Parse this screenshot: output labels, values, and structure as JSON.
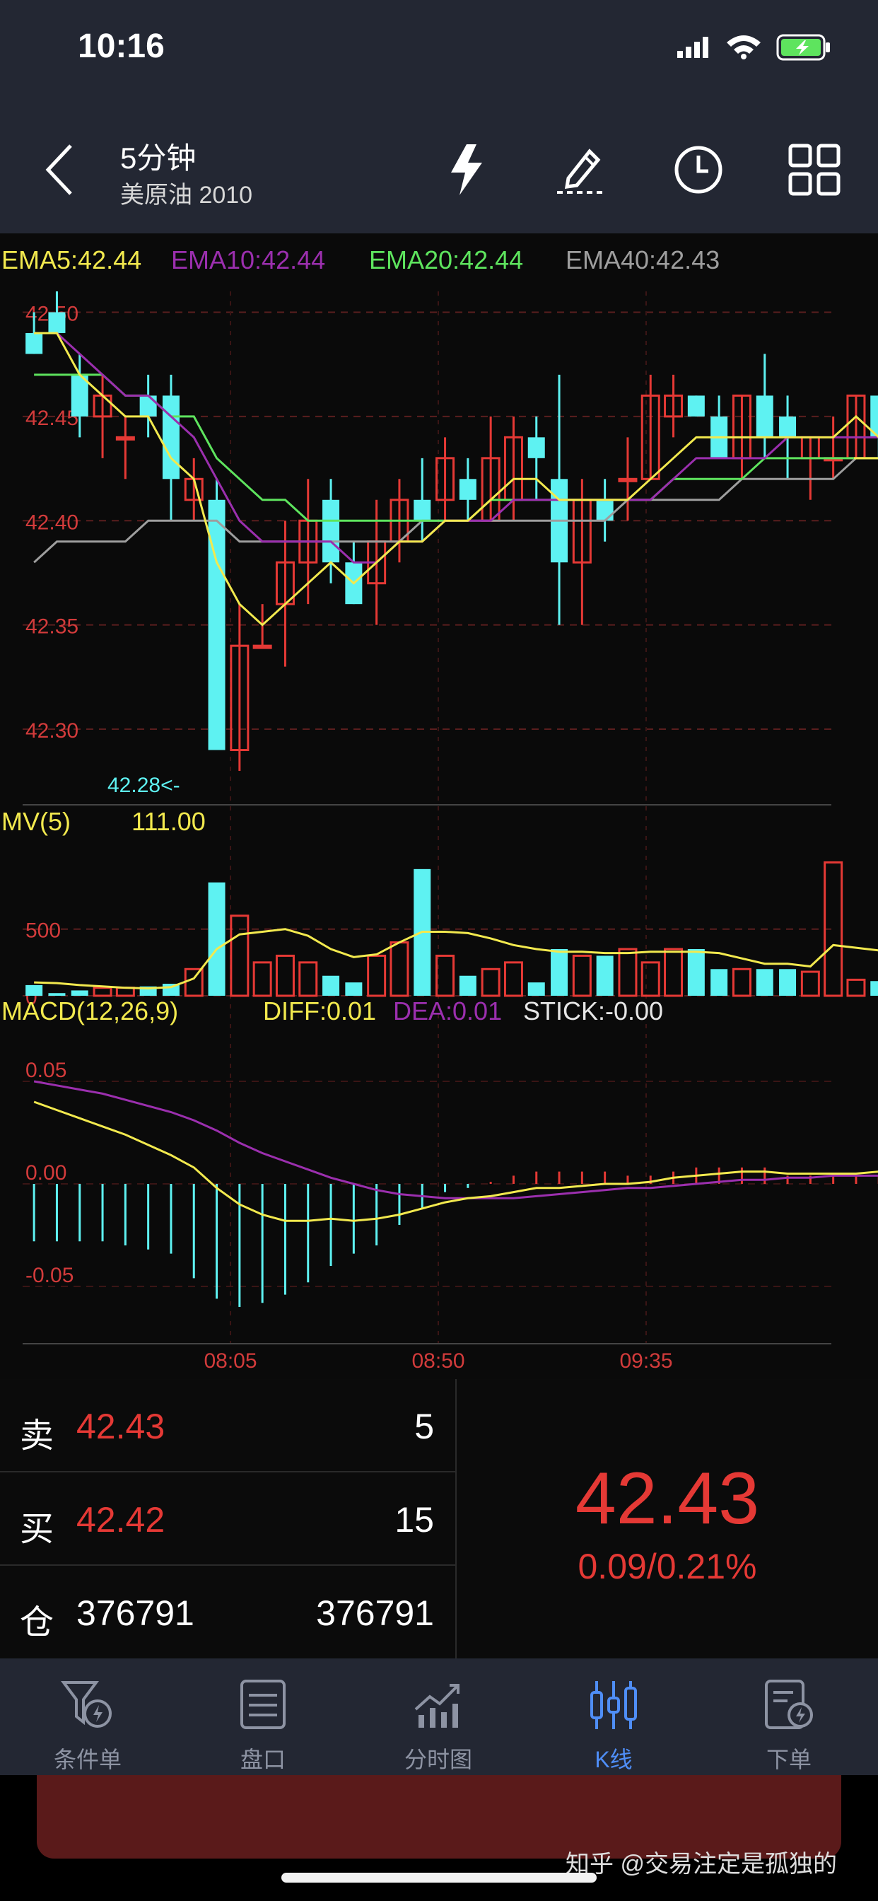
{
  "status_bar": {
    "time": "10:16"
  },
  "header": {
    "title": "5分钟",
    "subtitle": "美原油 2010"
  },
  "ema_legend": [
    {
      "label": "EMA5:42.44",
      "color": "#f2e94e"
    },
    {
      "label": "EMA10:42.44",
      "color": "#9b2fae"
    },
    {
      "label": "EMA20:42.44",
      "color": "#5ee45e"
    },
    {
      "label": "EMA40:42.43",
      "color": "#9e9e9e"
    }
  ],
  "colors": {
    "up": "#e53935",
    "down": "#5ef2f2",
    "bg": "#0a0a0a"
  },
  "chart_data": [
    {
      "type": "candlestick",
      "title": "",
      "y_ticks": [
        "42.50",
        "42.45",
        "42.40",
        "42.35",
        "42.30"
      ],
      "ylim": [
        42.28,
        42.51
      ],
      "x_ticks": [
        "08:05",
        "08:50",
        "09:35"
      ],
      "min_marker": "42.28<-",
      "candles": [
        {
          "o": 42.49,
          "h": 42.5,
          "l": 42.48,
          "c": 42.48
        },
        {
          "o": 42.5,
          "h": 42.51,
          "l": 42.49,
          "c": 42.49
        },
        {
          "o": 42.47,
          "h": 42.48,
          "l": 42.44,
          "c": 42.45
        },
        {
          "o": 42.45,
          "h": 42.47,
          "l": 42.43,
          "c": 42.46
        },
        {
          "o": 42.44,
          "h": 42.45,
          "l": 42.42,
          "c": 42.44
        },
        {
          "o": 42.46,
          "h": 42.47,
          "l": 42.44,
          "c": 42.45
        },
        {
          "o": 42.46,
          "h": 42.47,
          "l": 42.4,
          "c": 42.42
        },
        {
          "o": 42.41,
          "h": 42.43,
          "l": 42.4,
          "c": 42.42
        },
        {
          "o": 42.41,
          "h": 42.42,
          "l": 42.29,
          "c": 42.29
        },
        {
          "o": 42.29,
          "h": 42.36,
          "l": 42.28,
          "c": 42.34
        },
        {
          "o": 42.34,
          "h": 42.36,
          "l": 42.34,
          "c": 42.34
        },
        {
          "o": 42.36,
          "h": 42.4,
          "l": 42.33,
          "c": 42.38
        },
        {
          "o": 42.38,
          "h": 42.42,
          "l": 42.36,
          "c": 42.4
        },
        {
          "o": 42.41,
          "h": 42.42,
          "l": 42.37,
          "c": 42.38
        },
        {
          "o": 42.38,
          "h": 42.39,
          "l": 42.36,
          "c": 42.36
        },
        {
          "o": 42.37,
          "h": 42.41,
          "l": 42.35,
          "c": 42.39
        },
        {
          "o": 42.39,
          "h": 42.42,
          "l": 42.38,
          "c": 42.41
        },
        {
          "o": 42.41,
          "h": 42.43,
          "l": 42.39,
          "c": 42.4
        },
        {
          "o": 42.41,
          "h": 42.44,
          "l": 42.4,
          "c": 42.43
        },
        {
          "o": 42.42,
          "h": 42.43,
          "l": 42.4,
          "c": 42.41
        },
        {
          "o": 42.4,
          "h": 42.45,
          "l": 42.4,
          "c": 42.43
        },
        {
          "o": 42.41,
          "h": 42.45,
          "l": 42.4,
          "c": 42.44
        },
        {
          "o": 42.44,
          "h": 42.45,
          "l": 42.41,
          "c": 42.43
        },
        {
          "o": 42.42,
          "h": 42.47,
          "l": 42.35,
          "c": 42.38
        },
        {
          "o": 42.38,
          "h": 42.42,
          "l": 42.35,
          "c": 42.41
        },
        {
          "o": 42.41,
          "h": 42.42,
          "l": 42.39,
          "c": 42.4
        },
        {
          "o": 42.42,
          "h": 42.44,
          "l": 42.4,
          "c": 42.42
        },
        {
          "o": 42.42,
          "h": 42.47,
          "l": 42.42,
          "c": 42.46
        },
        {
          "o": 42.45,
          "h": 42.47,
          "l": 42.44,
          "c": 42.46
        },
        {
          "o": 42.46,
          "h": 42.46,
          "l": 42.45,
          "c": 42.45
        },
        {
          "o": 42.45,
          "h": 42.46,
          "l": 42.43,
          "c": 42.43
        },
        {
          "o": 42.43,
          "h": 42.46,
          "l": 42.42,
          "c": 42.46
        },
        {
          "o": 42.46,
          "h": 42.48,
          "l": 42.43,
          "c": 42.44
        },
        {
          "o": 42.45,
          "h": 42.46,
          "l": 42.42,
          "c": 42.44
        },
        {
          "o": 42.43,
          "h": 42.44,
          "l": 42.41,
          "c": 42.44
        },
        {
          "o": 42.43,
          "h": 42.45,
          "l": 42.42,
          "c": 42.43
        },
        {
          "o": 42.43,
          "h": 42.46,
          "l": 42.43,
          "c": 42.46
        },
        {
          "o": 42.46,
          "h": 42.46,
          "l": 42.43,
          "c": 42.44
        },
        {
          "o": 42.45,
          "h": 42.45,
          "l": 42.43,
          "c": 42.44
        },
        {
          "o": 42.44,
          "h": 42.44,
          "l": 42.43,
          "c": 42.43
        }
      ],
      "ema5": [
        42.49,
        42.49,
        42.47,
        42.46,
        42.45,
        42.45,
        42.43,
        42.42,
        42.38,
        42.36,
        42.35,
        42.36,
        42.37,
        42.38,
        42.37,
        42.38,
        42.39,
        42.39,
        42.4,
        42.4,
        42.41,
        42.42,
        42.42,
        42.41,
        42.41,
        42.41,
        42.41,
        42.42,
        42.43,
        42.44,
        42.44,
        42.44,
        42.44,
        42.44,
        42.44,
        42.44,
        42.45,
        42.44,
        42.44,
        42.44
      ],
      "ema10": [
        42.49,
        42.49,
        42.48,
        42.47,
        42.46,
        42.46,
        42.45,
        42.44,
        42.42,
        42.4,
        42.39,
        42.39,
        42.39,
        42.39,
        42.38,
        42.38,
        42.39,
        42.39,
        42.4,
        42.4,
        42.4,
        42.41,
        42.41,
        42.41,
        42.41,
        42.41,
        42.41,
        42.41,
        42.42,
        42.43,
        42.43,
        42.43,
        42.43,
        42.44,
        42.44,
        42.44,
        42.44,
        42.44,
        42.44,
        42.44
      ],
      "ema20": [
        42.47,
        42.47,
        42.47,
        42.47,
        42.46,
        42.46,
        42.45,
        42.45,
        42.43,
        42.42,
        42.41,
        42.41,
        42.4,
        42.4,
        42.4,
        42.4,
        42.4,
        42.4,
        42.4,
        42.4,
        42.41,
        42.41,
        42.41,
        42.41,
        42.41,
        42.41,
        42.41,
        42.41,
        42.42,
        42.42,
        42.42,
        42.42,
        42.43,
        42.43,
        42.43,
        42.43,
        42.43,
        42.43,
        42.44,
        42.44
      ],
      "ema40": [
        42.38,
        42.39,
        42.39,
        42.39,
        42.39,
        42.4,
        42.4,
        42.4,
        42.4,
        42.39,
        42.39,
        42.39,
        42.39,
        42.39,
        42.39,
        42.39,
        42.39,
        42.4,
        42.4,
        42.4,
        42.4,
        42.4,
        42.4,
        42.4,
        42.4,
        42.4,
        42.41,
        42.41,
        42.41,
        42.41,
        42.41,
        42.42,
        42.42,
        42.42,
        42.42,
        42.42,
        42.43,
        42.43,
        42.43,
        42.43
      ]
    },
    {
      "type": "bar",
      "title": "MV(5)",
      "value_label": "111.00",
      "y_ticks": [
        "500",
        "0"
      ],
      "ylim": [
        0,
        1050
      ],
      "volumes": [
        80,
        20,
        40,
        60,
        60,
        70,
        90,
        200,
        850,
        600,
        250,
        300,
        250,
        150,
        100,
        300,
        400,
        950,
        300,
        150,
        200,
        250,
        100,
        350,
        300,
        300,
        350,
        250,
        350,
        350,
        200,
        200,
        200,
        200,
        180,
        1000,
        120,
        110,
        80,
        20
      ],
      "ma_values": [
        100,
        95,
        80,
        70,
        60,
        55,
        65,
        130,
        350,
        460,
        480,
        500,
        450,
        350,
        290,
        310,
        400,
        480,
        480,
        470,
        430,
        380,
        350,
        330,
        330,
        320,
        320,
        330,
        330,
        330,
        320,
        280,
        240,
        240,
        220,
        380,
        360,
        340,
        320,
        111
      ]
    },
    {
      "type": "bar",
      "title": "MACD(12,26,9)",
      "legend": [
        {
          "label": "DIFF:0.01",
          "color": "#f2e94e"
        },
        {
          "label": "DEA:0.01",
          "color": "#9b2fae"
        },
        {
          "label": "STICK:-0.00",
          "color": "#e6e6e6"
        }
      ],
      "y_ticks": [
        "0.05",
        "0.00",
        "-0.05"
      ],
      "ylim": [
        -0.06,
        0.06
      ],
      "diff": [
        0.04,
        0.036,
        0.032,
        0.028,
        0.024,
        0.019,
        0.014,
        0.008,
        -0.002,
        -0.01,
        -0.015,
        -0.018,
        -0.018,
        -0.017,
        -0.018,
        -0.017,
        -0.015,
        -0.012,
        -0.009,
        -0.007,
        -0.006,
        -0.004,
        -0.002,
        -0.002,
        -0.001,
        0.0,
        0.0,
        0.001,
        0.003,
        0.004,
        0.005,
        0.006,
        0.006,
        0.005,
        0.005,
        0.005,
        0.005,
        0.006,
        0.005,
        0.004
      ],
      "dea": [
        0.05,
        0.048,
        0.046,
        0.044,
        0.041,
        0.038,
        0.035,
        0.031,
        0.026,
        0.02,
        0.015,
        0.011,
        0.007,
        0.003,
        0.0,
        -0.003,
        -0.005,
        -0.006,
        -0.007,
        -0.007,
        -0.007,
        -0.007,
        -0.006,
        -0.005,
        -0.004,
        -0.003,
        -0.002,
        -0.002,
        -0.001,
        0.0,
        0.001,
        0.002,
        0.002,
        0.003,
        0.003,
        0.004,
        0.004,
        0.004,
        0.004,
        0.004
      ],
      "stick": [
        -0.028,
        -0.028,
        -0.028,
        -0.028,
        -0.03,
        -0.032,
        -0.034,
        -0.046,
        -0.056,
        -0.06,
        -0.058,
        -0.054,
        -0.048,
        -0.04,
        -0.034,
        -0.03,
        -0.02,
        -0.012,
        -0.004,
        -0.002,
        0.001,
        0.004,
        0.006,
        0.006,
        0.006,
        0.006,
        0.004,
        0.004,
        0.006,
        0.008,
        0.008,
        0.008,
        0.008,
        0.004,
        0.004,
        0.004,
        0.004,
        0.004,
        0.002,
        -0.002
      ]
    }
  ],
  "quote_panel": {
    "sell": {
      "label": "卖",
      "price": "42.43",
      "volume": "5"
    },
    "buy": {
      "label": "买",
      "price": "42.42",
      "volume": "15"
    },
    "position": {
      "label": "仓",
      "value": "376791",
      "value2": "376791"
    },
    "last_price": "42.43",
    "change": "0.09/0.21%"
  },
  "tabs": [
    {
      "label": "条件单",
      "icon": "condition-order-icon"
    },
    {
      "label": "盘口",
      "icon": "orderbook-icon"
    },
    {
      "label": "分时图",
      "icon": "timeshare-chart-icon"
    },
    {
      "label": "K线",
      "icon": "kline-icon",
      "active": true
    },
    {
      "label": "下单",
      "icon": "place-order-icon"
    }
  ],
  "watermark": "知乎 @交易注定是孤独的"
}
